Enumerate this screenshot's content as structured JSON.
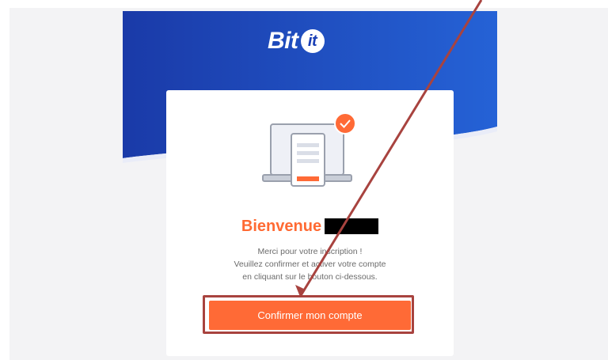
{
  "brand": {
    "logo_text": "Bit",
    "logo_mark": "it",
    "primary_color": "#1d47c0",
    "accent_color": "#ff6a36"
  },
  "card": {
    "greeting": "Bienvenue",
    "message_lines": [
      "Merci pour votre inscription !",
      "Veuillez confirmer et activer votre compte",
      "en cliquant sur le bouton ci-dessous."
    ],
    "confirm_label": "Confirmer mon compte"
  },
  "icons": {
    "illustration": "laptop-document-icon",
    "badge": "check-circle-icon"
  },
  "annotation": {
    "highlight_color": "#a8433f"
  }
}
